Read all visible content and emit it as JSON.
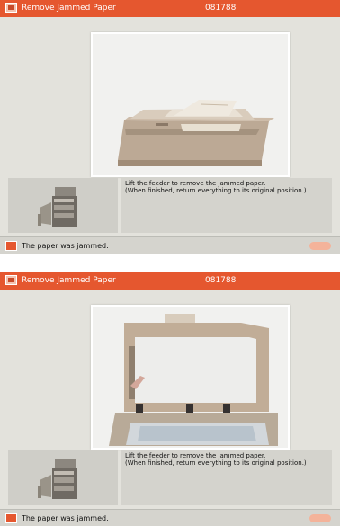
{
  "screens": [
    {
      "title": "Remove Jammed Paper",
      "code": "081788",
      "message_line1": "Lift the feeder to remove the jammed paper.",
      "message_line2": "(When finished, return everything to its original position.)",
      "status": "The paper was jammed.",
      "illustration": "feeder-closed"
    },
    {
      "title": "Remove Jammed Paper",
      "code": "081788",
      "message_line1": "Lift the feeder to remove the jammed paper.",
      "message_line2": "(When finished, return everything to its original position.)",
      "status": "The paper was jammed.",
      "illustration": "feeder-lifted"
    }
  ],
  "colors": {
    "accent": "#e5572f",
    "panel": "#e3e2dc",
    "frame": "#ffffff"
  }
}
